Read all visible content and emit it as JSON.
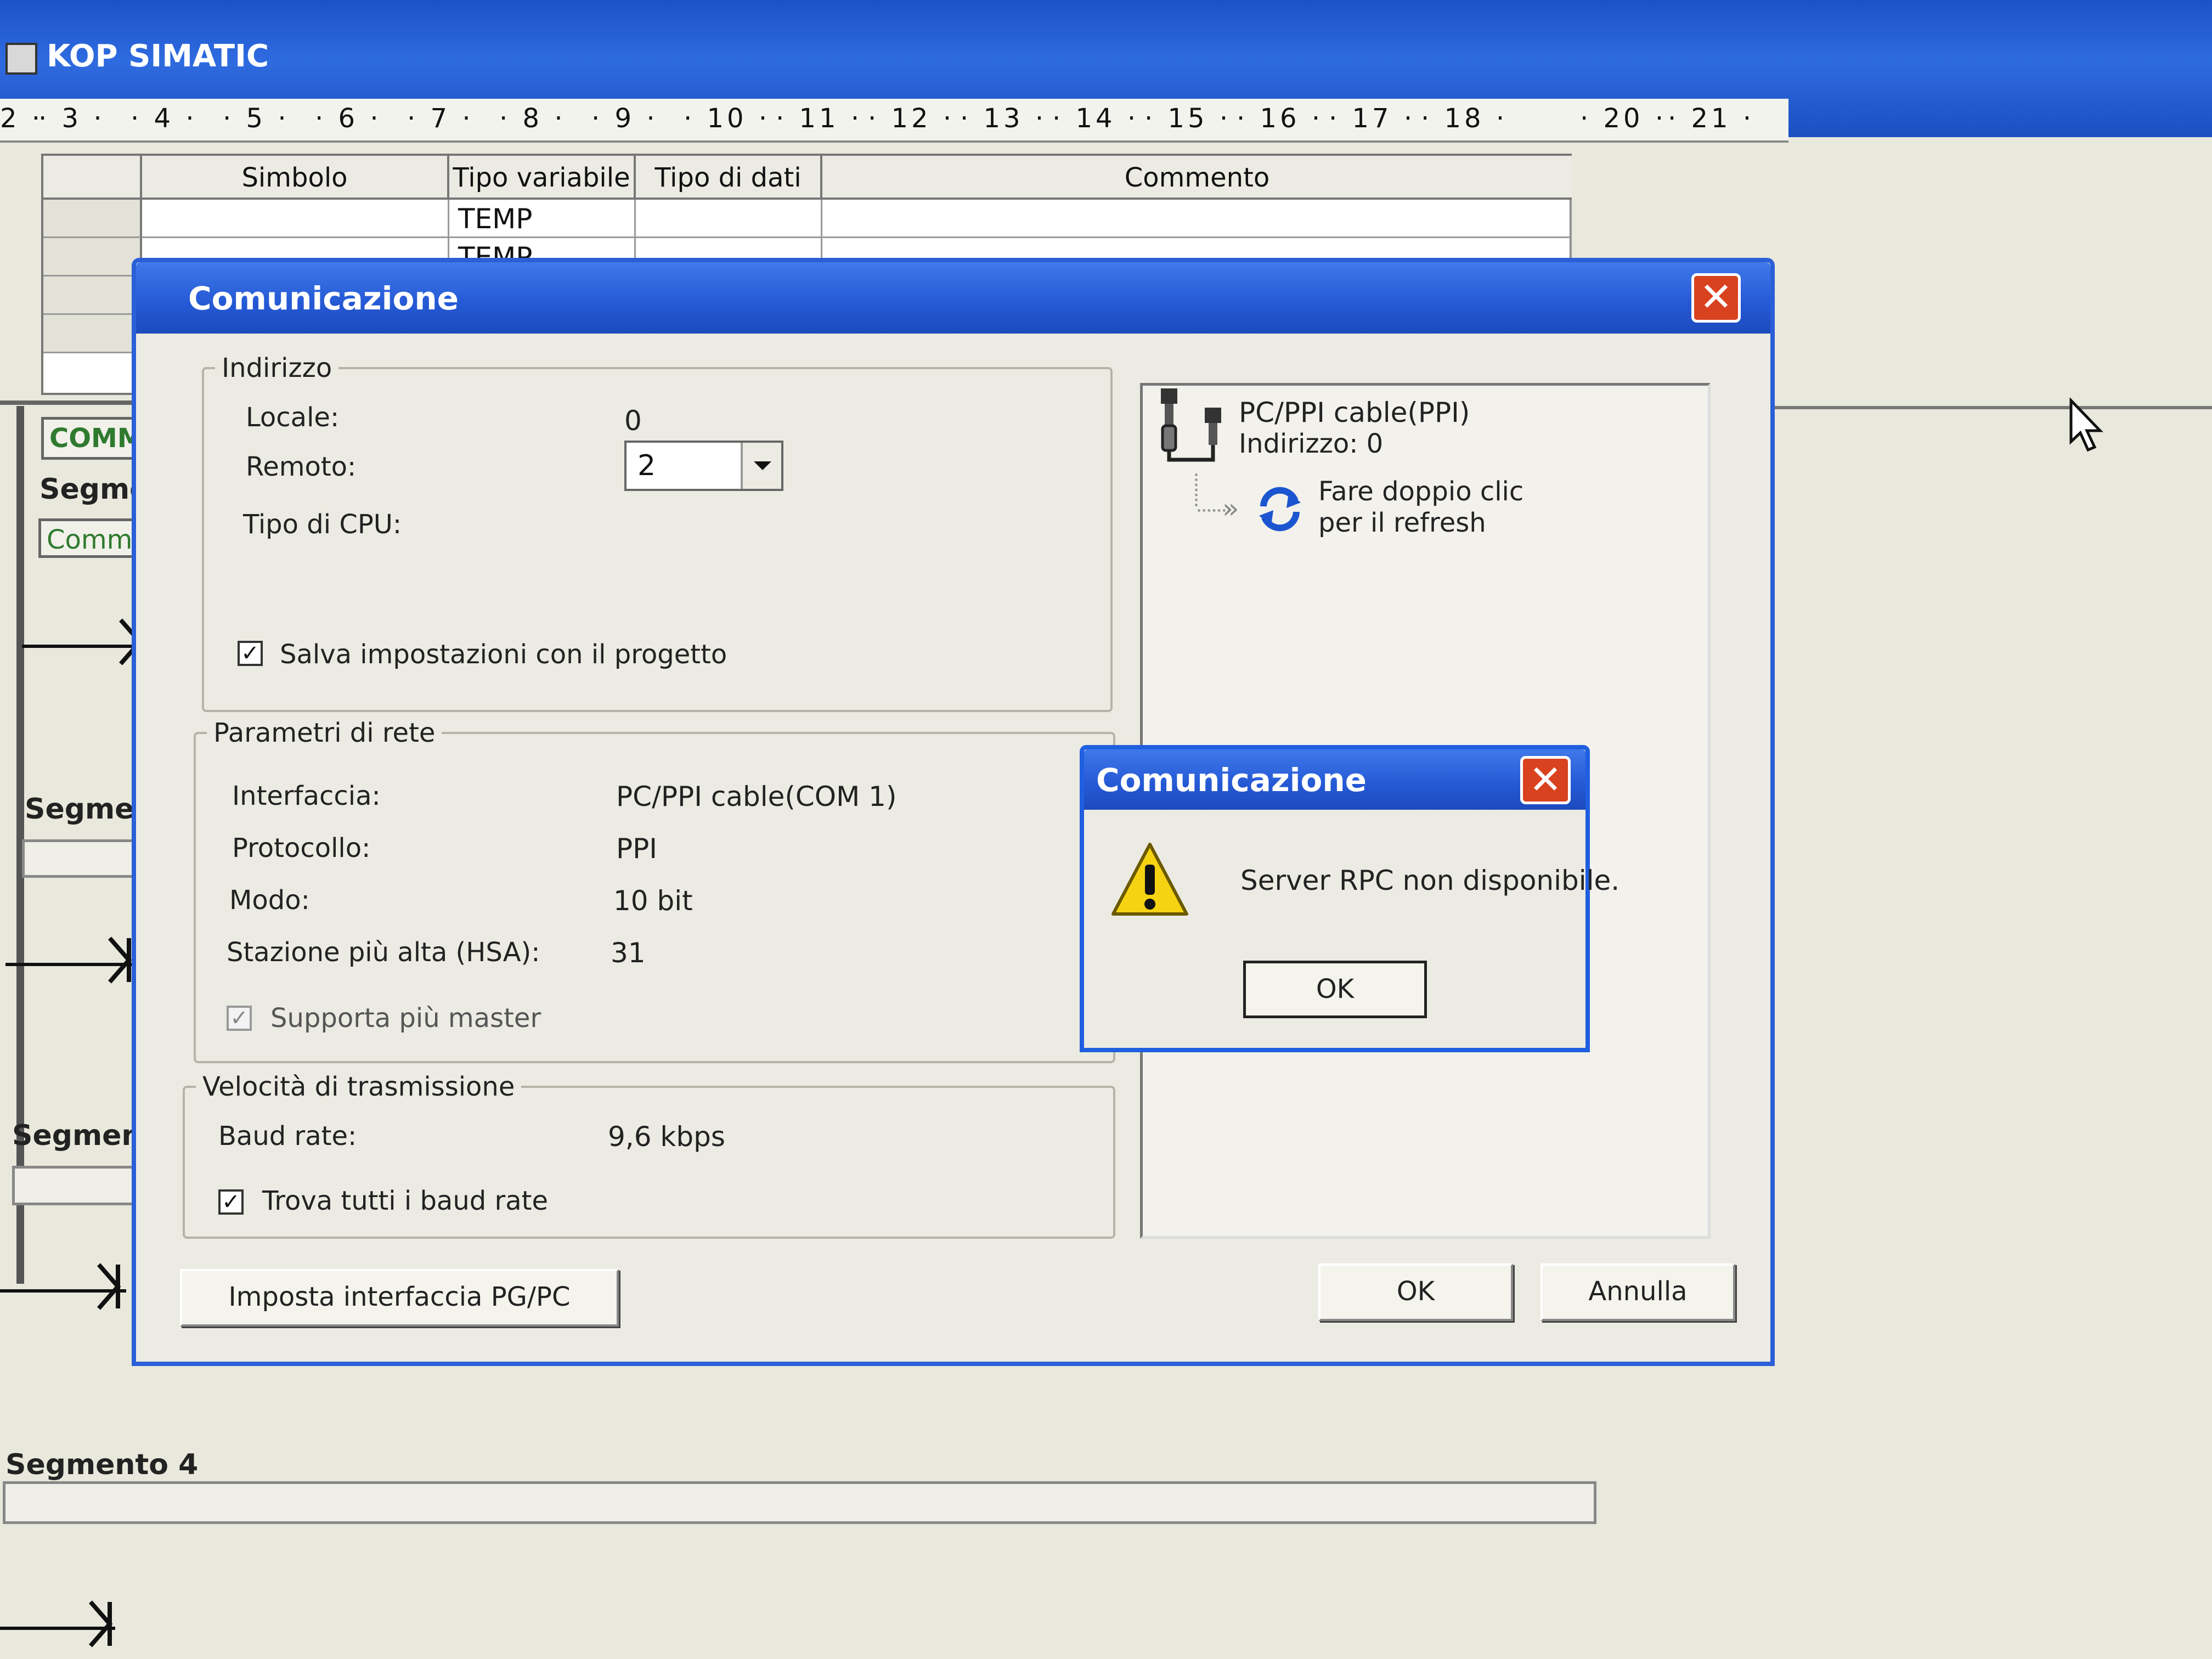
{
  "app": {
    "title": "KOP SIMATIC",
    "ruler": [
      "2 ·",
      "· 3 ·",
      "· 4 ·",
      "· 5 ·",
      "· 6 ·",
      "· 7 ·",
      "· 8 ·",
      "· 9 ·",
      "· 10 ·",
      "· 11 ·",
      "· 12 ·",
      "· 13 ·",
      "· 14 ·",
      "· 15 ·",
      "· 16 ·",
      "· 17 ·",
      "· 18 ·",
      "· 20 ·",
      "· 21 ·"
    ]
  },
  "var_table": {
    "headers": {
      "symbol": "Simbolo",
      "var_type": "Tipo variabile",
      "data_type": "Tipo di dati",
      "comment": "Commento"
    },
    "rows": [
      {
        "var_type": "TEMP"
      },
      {
        "var_type": "TEMP"
      }
    ]
  },
  "editor": {
    "comment_label": "COMMEN",
    "comment_placeholder": "Comment",
    "segment_partial": "Segment",
    "segment4_label": "Segmento 4"
  },
  "dialog": {
    "title": "Comunicazione",
    "address": {
      "legend": "Indirizzo",
      "local_label": "Locale:",
      "local_value": "0",
      "remote_label": "Remoto:",
      "remote_value": "2",
      "cpu_label": "Tipo di CPU:",
      "save_label": "Salva impostazioni con il progetto"
    },
    "network": {
      "legend": "Parametri di rete",
      "interface_label": "Interfaccia:",
      "interface_value": "PC/PPI cable(COM 1)",
      "protocol_label": "Protocollo:",
      "protocol_value": "PPI",
      "mode_label": "Modo:",
      "mode_value": "10 bit",
      "hsa_label": "Stazione più alta (HSA):",
      "hsa_value": "31",
      "multimaster_label": "Supporta più master"
    },
    "speed": {
      "legend": "Velocità di trasmissione",
      "baud_label": "Baud rate:",
      "baud_value": "9,6 kbps",
      "find_all_label": "Trova tutti i baud rate"
    },
    "tree": {
      "cable_name": "PC/PPI cable(PPI)",
      "cable_address": "Indirizzo: 0",
      "refresh_line1": "Fare doppio clic",
      "refresh_line2": "per il refresh"
    },
    "buttons": {
      "set_interface": "Imposta interfaccia PG/PC",
      "ok": "OK",
      "cancel": "Annulla"
    }
  },
  "message_box": {
    "title": "Comunicazione",
    "message": "Server RPC non disponibile.",
    "ok": "OK"
  },
  "colors": {
    "titlebar": "#2458d4",
    "close": "#d9421f",
    "window_bg": "#ecebe3",
    "warning": "#f5d312"
  }
}
